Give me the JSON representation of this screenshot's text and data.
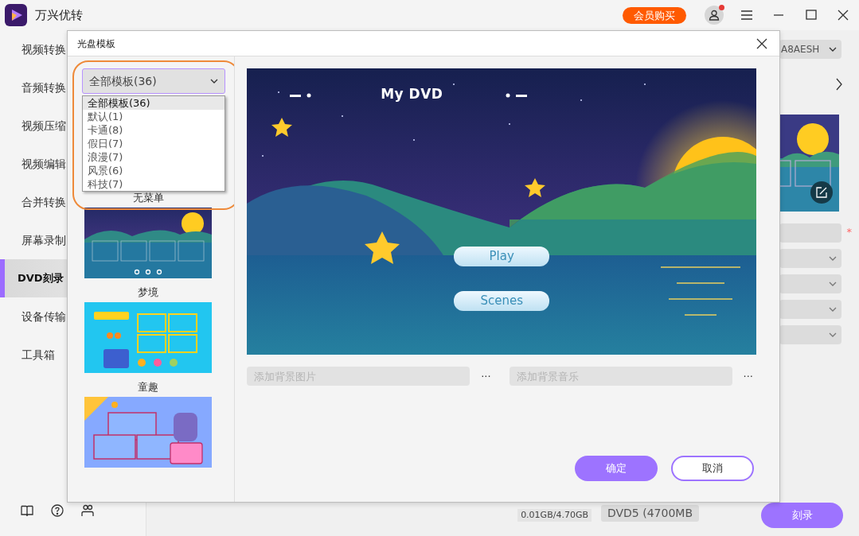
{
  "app": {
    "title": "万兴优转",
    "vip_button": "会员购买",
    "notification": true
  },
  "sidebar": {
    "items": [
      {
        "label": "视频转换",
        "selected": false
      },
      {
        "label": "音频转换",
        "selected": false
      },
      {
        "label": "视频压缩",
        "selected": false
      },
      {
        "label": "视频编辑",
        "selected": false
      },
      {
        "label": "合并转换",
        "selected": false
      },
      {
        "label": "屏幕录制",
        "selected": false
      },
      {
        "label": "DVD刻录",
        "selected": true
      },
      {
        "label": "设备传输",
        "selected": false
      },
      {
        "label": "工具箱",
        "selected": false
      }
    ]
  },
  "background_panel": {
    "disc_dropdown": "A8AESH",
    "required_mark": "*",
    "size_reading": "0.01GB/4.70GB",
    "disc_type": "DVD5 (4700MB",
    "burn_button": "刻录"
  },
  "dialog": {
    "title": "光盘模板",
    "category_select": {
      "value": "全部模板(36)",
      "expanded": true,
      "options": [
        {
          "label": "全部模板(36)",
          "selected": true
        },
        {
          "label": "默认(1)",
          "selected": false
        },
        {
          "label": "卡通(8)",
          "selected": false
        },
        {
          "label": "假日(7)",
          "selected": false
        },
        {
          "label": "浪漫(7)",
          "selected": false
        },
        {
          "label": "风景(6)",
          "selected": false
        },
        {
          "label": "科技(7)",
          "selected": false
        }
      ]
    },
    "templates": [
      {
        "kind": "none",
        "label": "无菜单"
      },
      {
        "kind": "dream",
        "label": "梦境"
      },
      {
        "kind": "kids",
        "label": "童趣"
      },
      {
        "kind": "anime"
      }
    ],
    "preview": {
      "title": "My DVD",
      "buttons": [
        "Play",
        "Scenes"
      ]
    },
    "background_image_field": {
      "placeholder": "添加背景图片"
    },
    "background_music_field": {
      "placeholder": "添加背景音乐"
    },
    "more_button": "···",
    "buttons": [
      {
        "label": "确定",
        "kind": "primary"
      },
      {
        "label": "取消",
        "kind": "outline"
      }
    ]
  }
}
